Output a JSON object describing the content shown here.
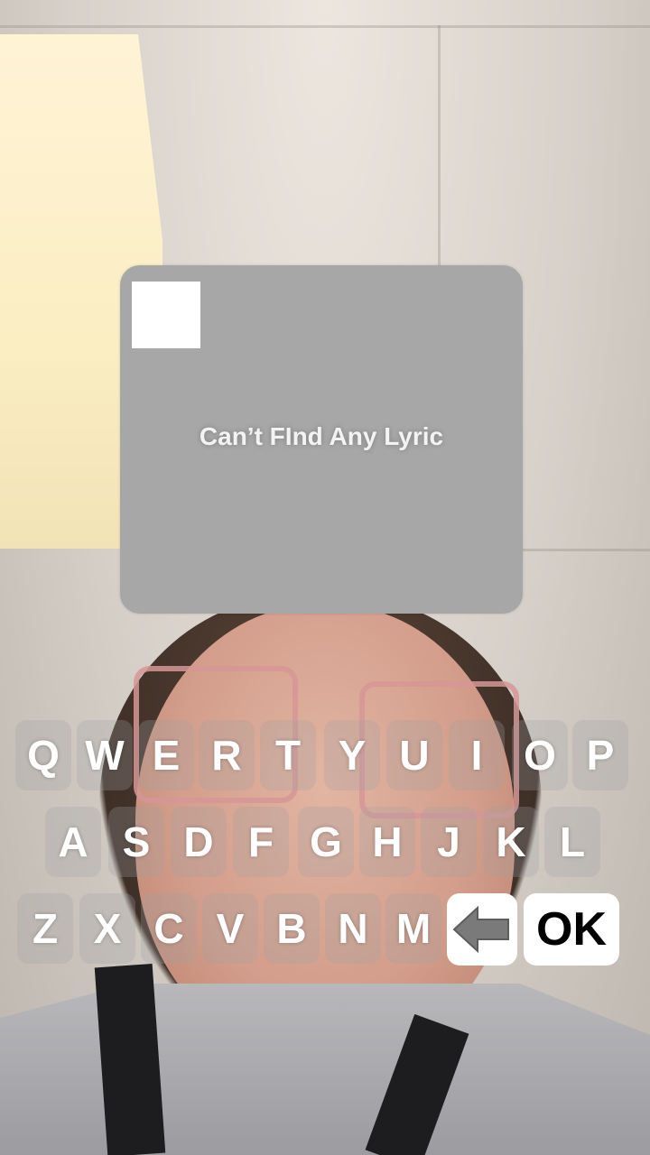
{
  "lyric_card": {
    "message": "Can’t FInd Any Lyric"
  },
  "keyboard": {
    "row1": [
      "Q",
      "W",
      "E",
      "R",
      "T",
      "Y",
      "U",
      "I",
      "O",
      "P"
    ],
    "row2": [
      "A",
      "S",
      "D",
      "F",
      "G",
      "H",
      "J",
      "K",
      "L"
    ],
    "row3": [
      "Z",
      "X",
      "C",
      "V",
      "B",
      "N",
      "M"
    ],
    "backspace_icon": "arrow-left-icon",
    "ok_label": "OK"
  },
  "colors": {
    "card_bg": "#a7a7a7",
    "key_bg": "rgba(160,160,160,0.28)",
    "action_key_bg": "#ffffff",
    "backspace_arrow": "#7a7a7a"
  }
}
